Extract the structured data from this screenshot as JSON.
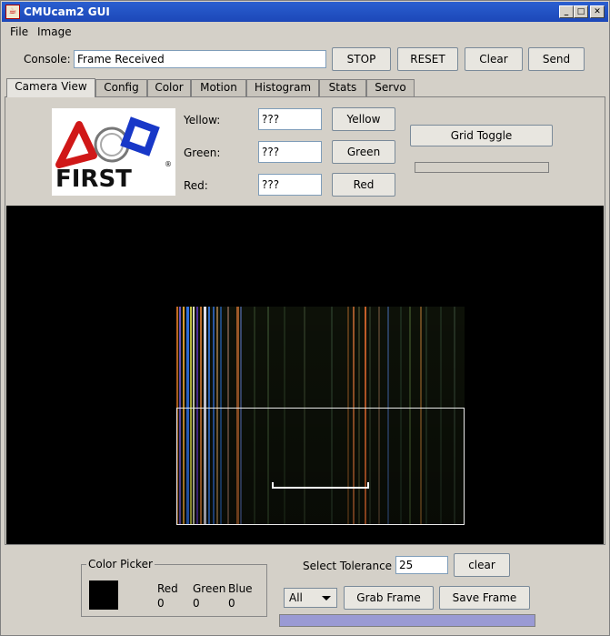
{
  "window": {
    "title": "CMUcam2 GUI",
    "app_icon": "java-cup-icon",
    "titlebar_color": "#1c47b8"
  },
  "menubar": {
    "file": "File",
    "image": "Image"
  },
  "console": {
    "label": "Console:",
    "value": "Frame Received",
    "stop": "STOP",
    "reset": "RESET",
    "clear": "Clear",
    "send": "Send"
  },
  "tabs": [
    {
      "label": "Camera View",
      "active": true
    },
    {
      "label": "Config"
    },
    {
      "label": "Color"
    },
    {
      "label": "Motion"
    },
    {
      "label": "Histogram"
    },
    {
      "label": "Stats"
    },
    {
      "label": "Servo"
    }
  ],
  "logo": {
    "text": "FIRST",
    "mark": "®"
  },
  "colors": {
    "yellow": {
      "label": "Yellow:",
      "value": "???",
      "button": "Yellow"
    },
    "green": {
      "label": "Green:",
      "value": "???",
      "button": "Green"
    },
    "red": {
      "label": "Red:",
      "value": "???",
      "button": "Red"
    }
  },
  "grid_toggle": "Grid Toggle",
  "picker": {
    "title": "Color Picker",
    "red_label": "Red",
    "green_label": "Green",
    "blue_label": "Blue",
    "red": "0",
    "green": "0",
    "blue": "0",
    "swatch_color": "#000000"
  },
  "tolerance": {
    "label": "Select Tolerance",
    "value": "25",
    "clear": "clear"
  },
  "frame_controls": {
    "selected": "All",
    "grab": "Grab Frame",
    "save": "Save Frame"
  },
  "progress_fill_color": "#9a9ad4"
}
